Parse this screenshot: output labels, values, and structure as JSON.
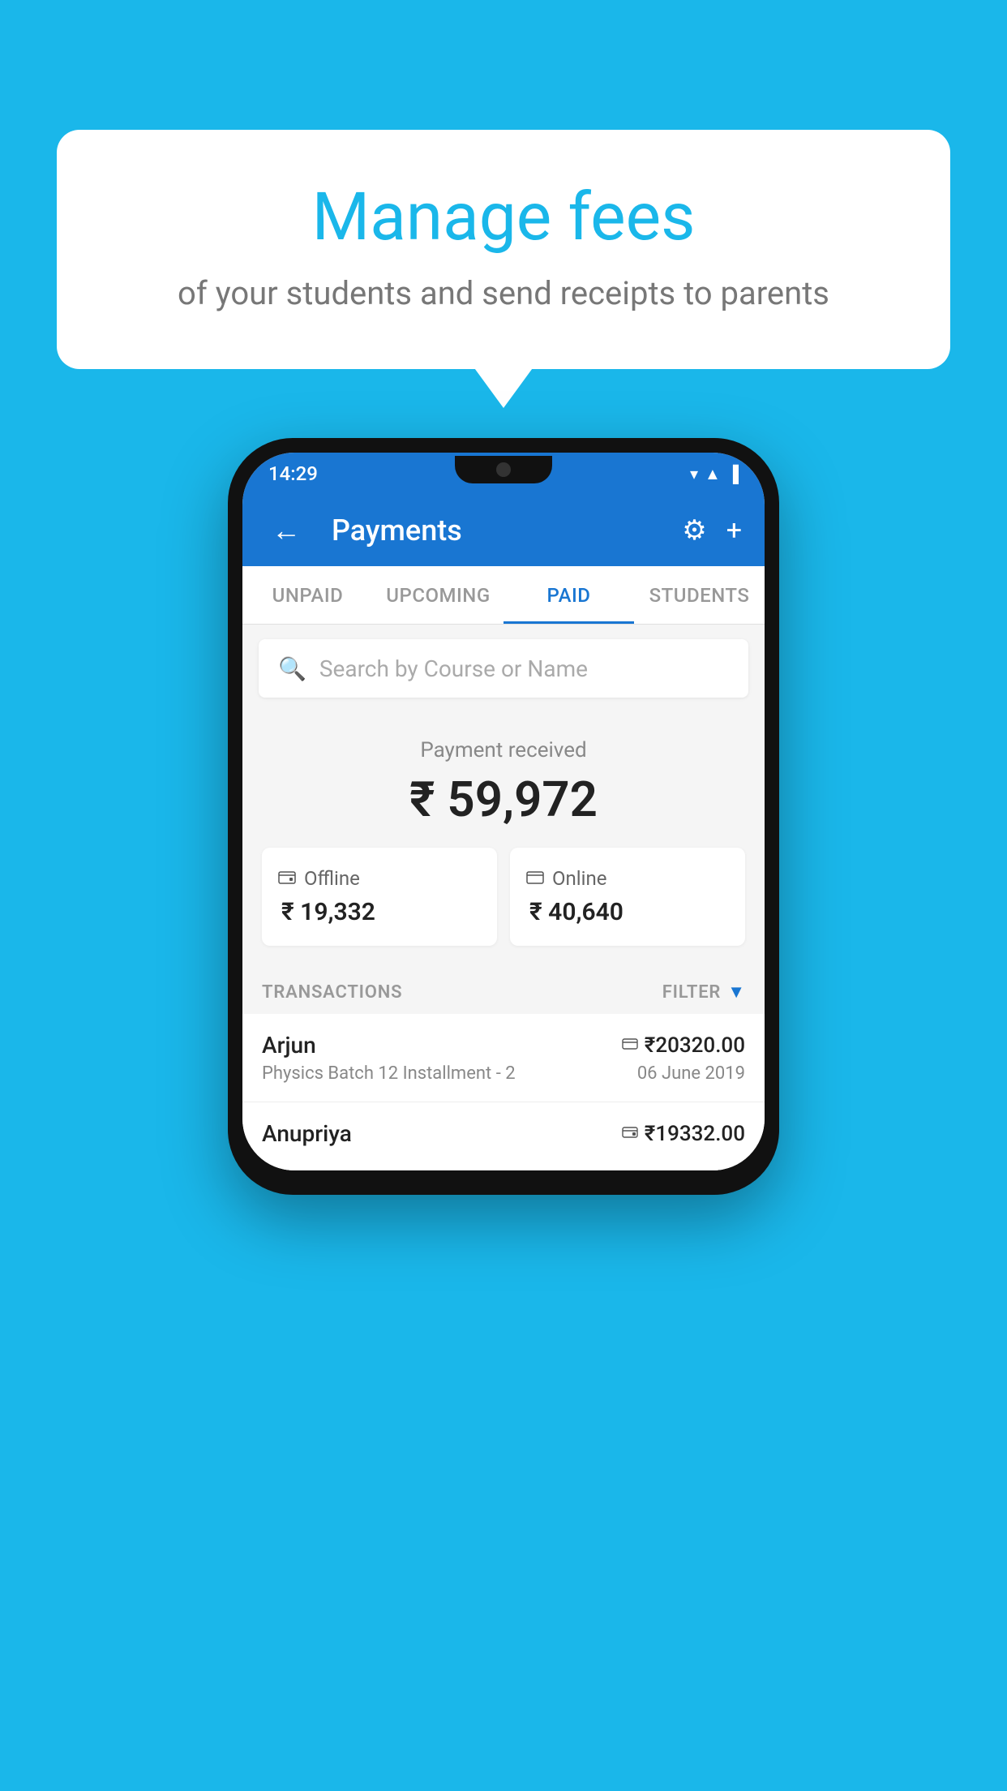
{
  "background_color": "#1ab7ea",
  "bubble": {
    "title": "Manage fees",
    "subtitle": "of your students and send receipts to parents"
  },
  "status_bar": {
    "time": "14:29",
    "wifi_icon": "▲",
    "signal_icon": "▲",
    "battery_icon": "▐"
  },
  "app_bar": {
    "title": "Payments",
    "back_label": "←",
    "settings_icon": "⚙",
    "add_icon": "+"
  },
  "tabs": [
    {
      "label": "UNPAID",
      "active": false
    },
    {
      "label": "UPCOMING",
      "active": false
    },
    {
      "label": "PAID",
      "active": true
    },
    {
      "label": "STUDENTS",
      "active": false
    }
  ],
  "search": {
    "placeholder": "Search by Course or Name"
  },
  "payment_summary": {
    "label": "Payment received",
    "amount": "₹ 59,972",
    "offline": {
      "type": "Offline",
      "amount": "₹ 19,332"
    },
    "online": {
      "type": "Online",
      "amount": "₹ 40,640"
    }
  },
  "transactions": {
    "header": "TRANSACTIONS",
    "filter": "FILTER",
    "items": [
      {
        "name": "Arjun",
        "amount": "₹20320.00",
        "description": "Physics Batch 12 Installment - 2",
        "date": "06 June 2019",
        "payment_type": "online"
      },
      {
        "name": "Anupriya",
        "amount": "₹19332.00",
        "description": "",
        "date": "",
        "payment_type": "offline"
      }
    ]
  }
}
